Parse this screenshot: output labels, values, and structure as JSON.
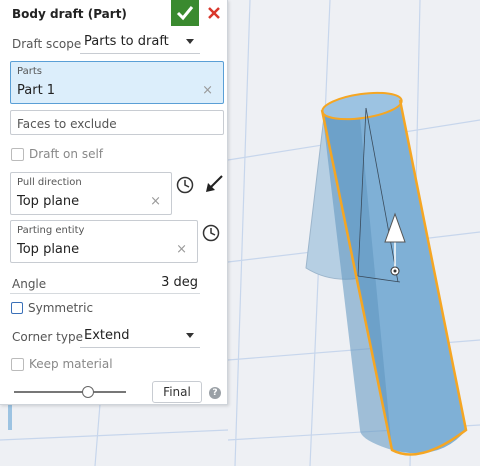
{
  "panel": {
    "title": "Body draft (Part)",
    "draft_scope": {
      "label": "Draft scope",
      "value": "Parts to draft"
    },
    "parts": {
      "caption": "Parts",
      "value": "Part 1"
    },
    "faces_to_exclude": {
      "placeholder": "Faces to exclude"
    },
    "draft_on_self": {
      "label": "Draft on self",
      "checked": false
    },
    "pull_direction": {
      "caption": "Pull direction",
      "value": "Top plane"
    },
    "parting_entity": {
      "caption": "Parting entity",
      "value": "Top plane"
    },
    "angle": {
      "label": "Angle",
      "value": "3 deg"
    },
    "symmetric": {
      "label": "Symmetric",
      "checked": false
    },
    "corner_type": {
      "label": "Corner type",
      "value": "Extend"
    },
    "keep_material": {
      "label": "Keep material",
      "checked": false
    },
    "slider": {
      "position": 0.65
    },
    "final_label": "Final",
    "help_symbol": "?"
  },
  "icons": {
    "ok": "checkmark-icon",
    "cancel": "close-icon",
    "history": "clock-icon",
    "flip": "flip-arrow-icon",
    "clear": "×"
  },
  "colors": {
    "ok_green": "#3a8a2f",
    "cancel_red": "#d9372b",
    "active_field": "#dceefb",
    "part_fill": "#7fb0d6",
    "part_highlight": "#f5a623"
  }
}
